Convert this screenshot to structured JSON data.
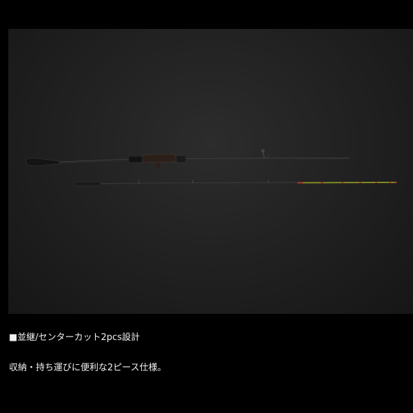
{
  "product_image": {
    "subject": "rod-two-piece-icon"
  },
  "feature": {
    "heading": "■並継/センターカット2pcs設計",
    "description": "収納・持ち運びに便利な2ピース仕様。"
  },
  "colors": {
    "page_background": "#000000",
    "photo_background": "#222222",
    "text": "#f2f2f2",
    "tip_accent_yellow": "#b7c22a",
    "tip_accent_red": "#b8322a"
  }
}
